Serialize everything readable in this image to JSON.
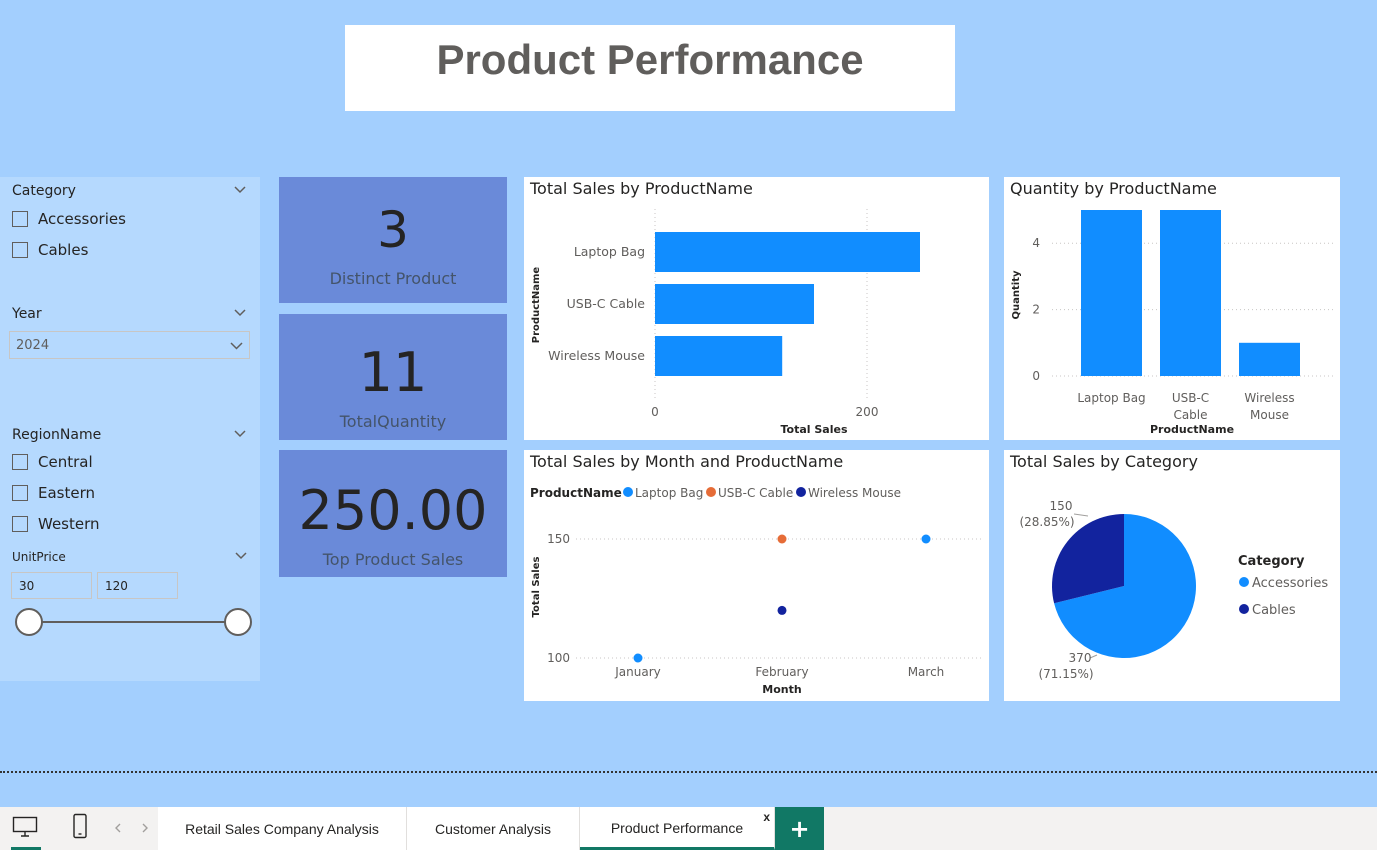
{
  "page": {
    "title": "Product Performance"
  },
  "slicers": {
    "category": {
      "title": "Category",
      "items": [
        "Accessories",
        "Cables"
      ]
    },
    "year": {
      "title": "Year",
      "selected": "2024"
    },
    "region": {
      "title": "RegionName",
      "items": [
        "Central",
        "Eastern",
        "Western"
      ]
    },
    "unit_price": {
      "title": "UnitPrice",
      "min": "30",
      "max": "120"
    }
  },
  "cards": [
    {
      "value": "3",
      "label": "Distinct Product"
    },
    {
      "value": "11",
      "label": "TotalQuantity"
    },
    {
      "value": "250.00",
      "label": "Top Product Sales"
    }
  ],
  "chart_data": [
    {
      "type": "bar",
      "orientation": "horizontal",
      "title": "Total Sales by ProductName",
      "xlabel": "Total Sales",
      "ylabel": "ProductName",
      "categories": [
        "Laptop Bag",
        "USB-C Cable",
        "Wireless Mouse"
      ],
      "values": [
        250,
        150,
        120
      ],
      "xticks": [
        "0",
        "200"
      ],
      "xlim": [
        0,
        300
      ],
      "color": "#118dff"
    },
    {
      "type": "bar",
      "title": "Quantity by ProductName",
      "xlabel": "ProductName",
      "ylabel": "Quantity",
      "categories": [
        "Laptop Bag",
        "USB-C Cable",
        "Wireless Mouse"
      ],
      "values": [
        5,
        5,
        1
      ],
      "yticks": [
        "0",
        "2",
        "4"
      ],
      "ylim": [
        0,
        5
      ],
      "color": "#118dff"
    },
    {
      "type": "scatter",
      "title": "Total Sales by Month and ProductName",
      "xlabel": "Month",
      "ylabel": "Total Sales",
      "legend_title": "ProductName",
      "categories": [
        "January",
        "February",
        "March"
      ],
      "series": [
        {
          "name": "Laptop Bag",
          "color": "#118dff",
          "points": [
            [
              "January",
              100
            ],
            [
              "March",
              150
            ]
          ]
        },
        {
          "name": "USB-C Cable",
          "color": "#e66c37",
          "points": [
            [
              "February",
              150
            ]
          ]
        },
        {
          "name": "Wireless Mouse",
          "color": "#12239e",
          "points": [
            [
              "February",
              120
            ]
          ]
        }
      ],
      "yticks": [
        "100",
        "150"
      ],
      "ylim": [
        100,
        150
      ]
    },
    {
      "type": "pie",
      "title": "Total Sales by Category",
      "legend_title": "Category",
      "slices": [
        {
          "name": "Accessories",
          "value": 370,
          "label": "370",
          "pct": "(71.15%)",
          "color": "#118dff"
        },
        {
          "name": "Cables",
          "value": 150,
          "label": "150",
          "pct": "(28.85%)",
          "color": "#12239e"
        }
      ]
    }
  ],
  "tabs": [
    "Retail Sales Company Analysis",
    "Customer Analysis",
    "Product Performance"
  ],
  "tab_close": "x",
  "add_tab_label": "+",
  "icons": {
    "desktop": "desktop-icon",
    "mobile": "mobile-icon",
    "prev": "chevron-left-icon",
    "next": "chevron-right-icon"
  }
}
